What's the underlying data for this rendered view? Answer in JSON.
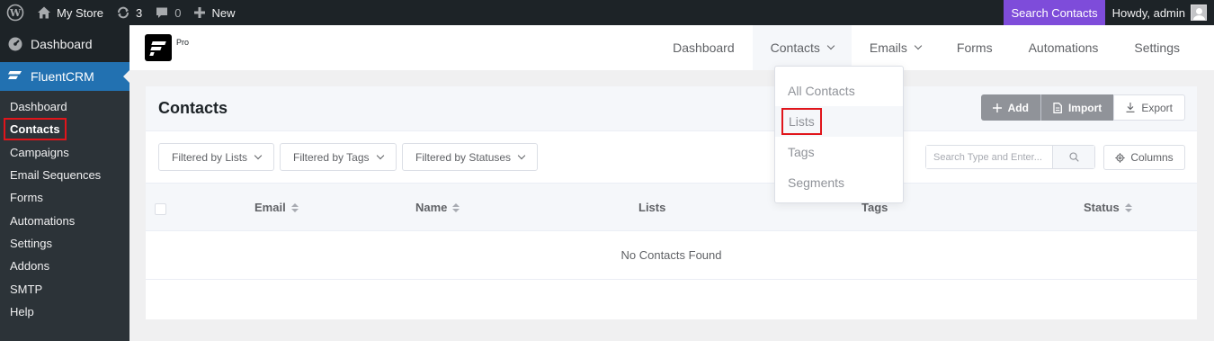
{
  "adminbar": {
    "site_name": "My Store",
    "updates_count": "3",
    "comments_count": "0",
    "new_label": "New",
    "search_contacts": "Search Contacts",
    "howdy": "Howdy, admin"
  },
  "sidebar": {
    "dashboard": "Dashboard",
    "plugin": "FluentCRM",
    "items": [
      "Dashboard",
      "Contacts",
      "Campaigns",
      "Email Sequences",
      "Forms",
      "Automations",
      "Settings",
      "Addons",
      "SMTP",
      "Help"
    ]
  },
  "crm_nav": {
    "pro": "Pro",
    "items": [
      "Dashboard",
      "Contacts",
      "Emails",
      "Forms",
      "Automations",
      "Settings"
    ]
  },
  "dropdown": {
    "items": [
      "All Contacts",
      "Lists",
      "Tags",
      "Segments"
    ]
  },
  "contacts": {
    "title": "Contacts",
    "add": "Add",
    "import": "Import",
    "export": "Export",
    "filters": [
      "Filtered by Lists",
      "Filtered by Tags",
      "Filtered by Statuses"
    ],
    "search_placeholder": "Search Type and Enter...",
    "columns": "Columns",
    "table_headers": [
      "Email",
      "Name",
      "Lists",
      "Tags",
      "Status"
    ],
    "empty": "No Contacts Found"
  },
  "colors": {
    "wp_dark": "#1d2327",
    "wp_blue": "#2271b1",
    "search_purple": "#7e4cda",
    "highlight_red": "#e0151b"
  }
}
